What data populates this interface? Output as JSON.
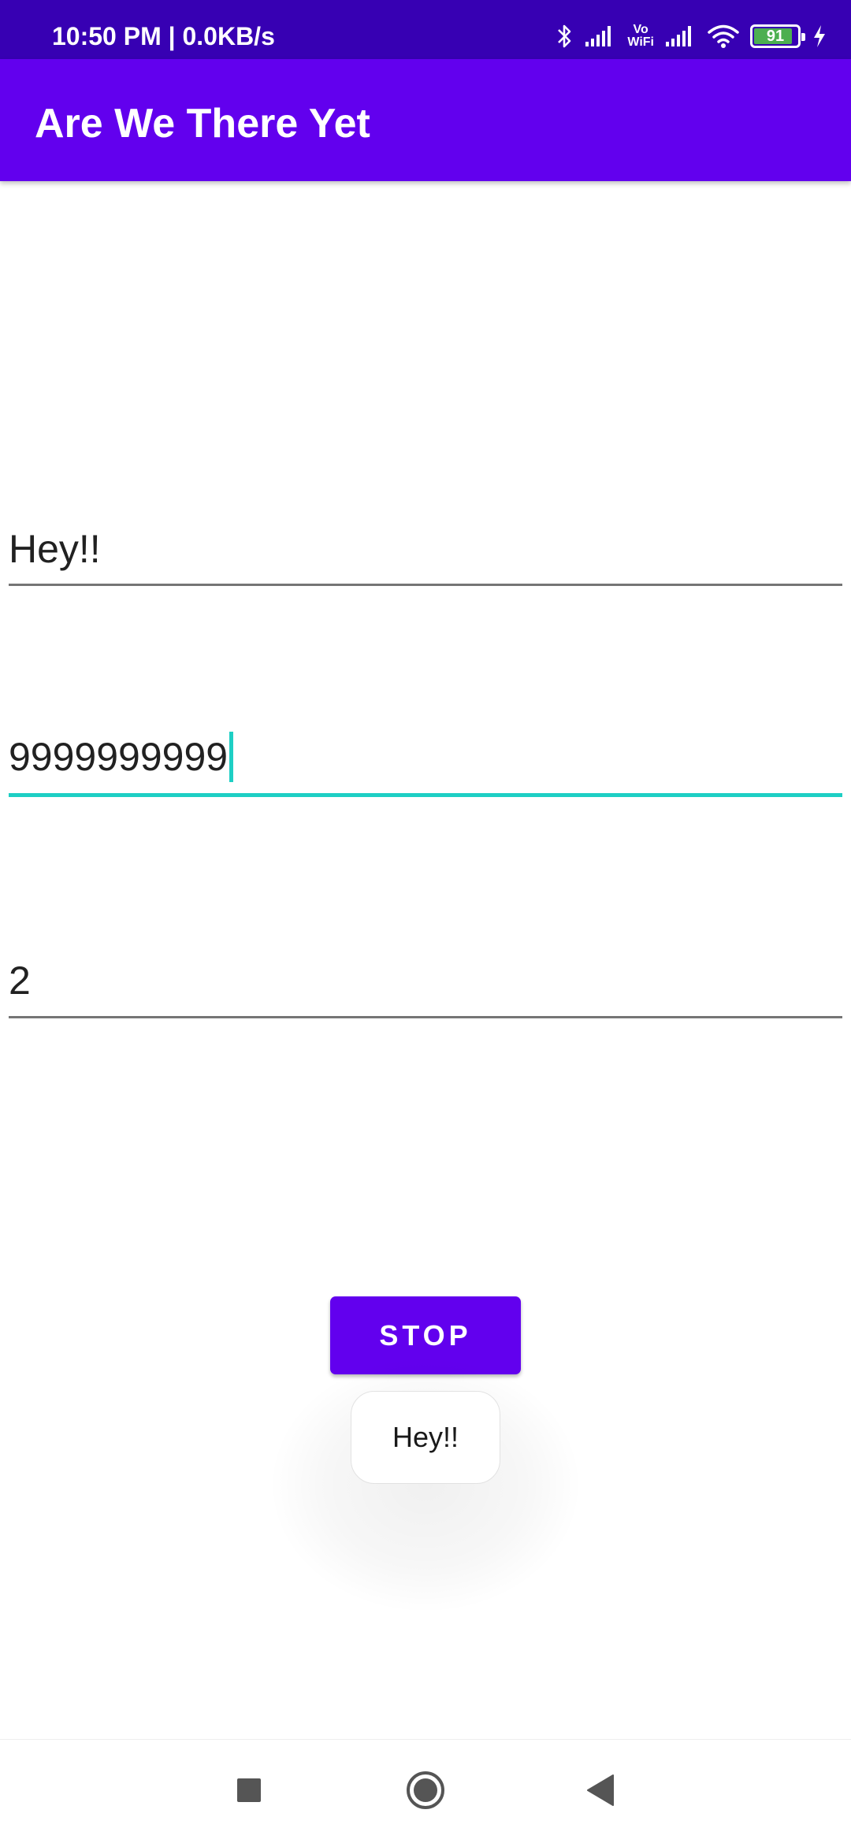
{
  "status_bar": {
    "time": "10:50 PM | 0.0KB/s",
    "vowifi_line1": "Vo",
    "vowifi_line2": "WiFi",
    "battery_level": "91",
    "icons": [
      "bluetooth-icon",
      "signal-icon",
      "vowifi-icon",
      "signal-icon",
      "wifi-icon",
      "battery-icon",
      "charging-icon"
    ]
  },
  "app_bar": {
    "title": "Are We There Yet"
  },
  "form": {
    "message_value": "Hey!!",
    "phone_value": "9999999999",
    "interval_value": "2"
  },
  "stop_button": {
    "label": "STOP"
  },
  "toast": {
    "text": "Hey!!"
  },
  "nav_bar": {
    "recents": "recents-icon",
    "home": "home-icon",
    "back": "back-icon"
  },
  "colors": {
    "status_bar": "#3700b3",
    "app_bar": "#6200ee",
    "accent": "#1ecfc4",
    "battery_fill": "#4caf50"
  }
}
